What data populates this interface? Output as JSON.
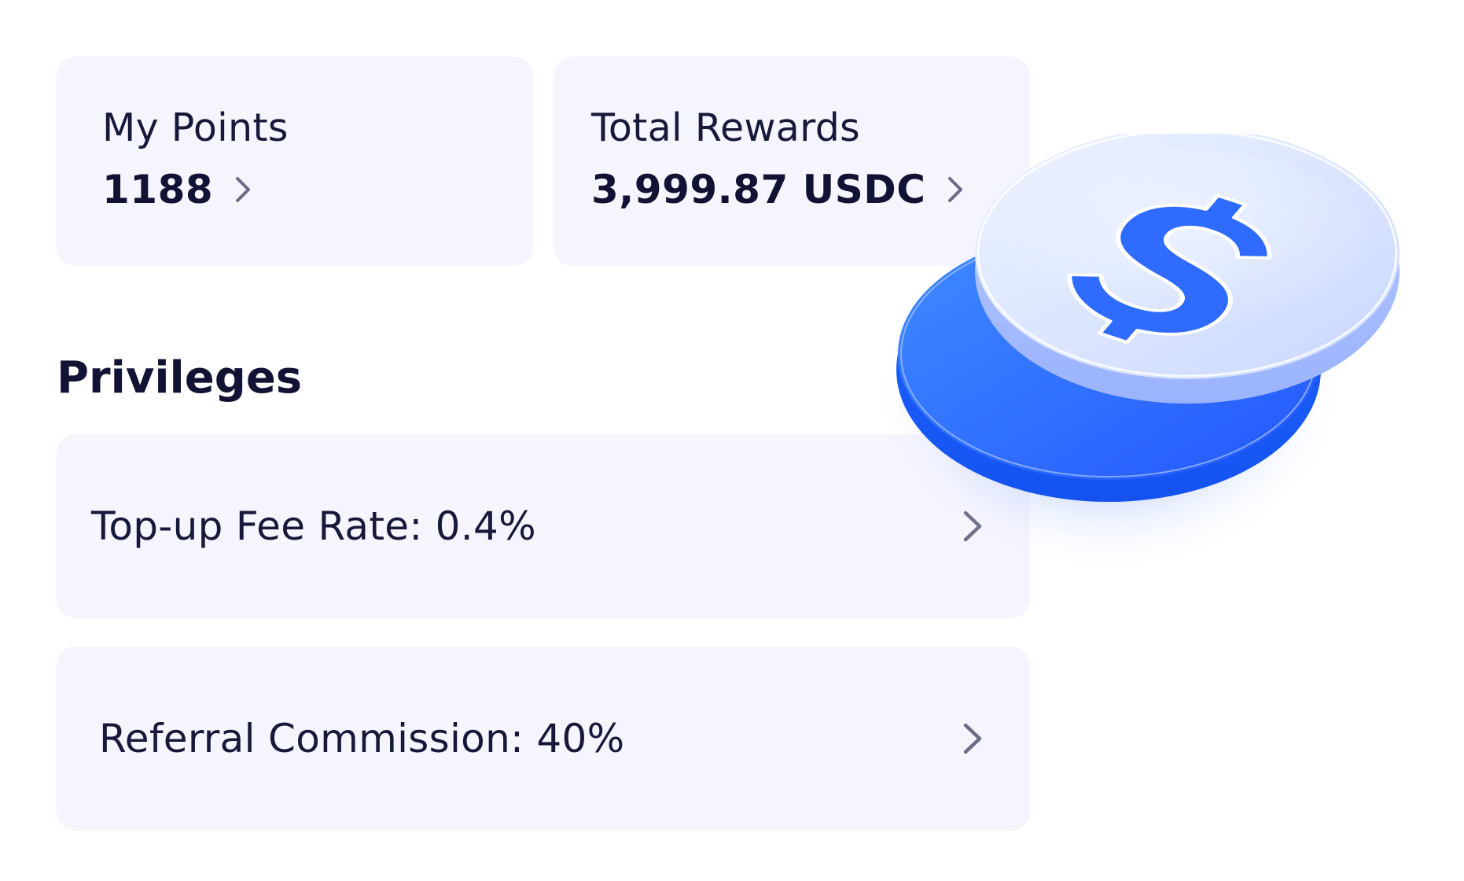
{
  "stats": {
    "points": {
      "title": "My Points",
      "value": "1188"
    },
    "rewards": {
      "title": "Total Rewards",
      "value": "3,999.87 USDC"
    }
  },
  "privileges": {
    "title": "Privileges",
    "items": [
      {
        "label": "Top-up Fee Rate: 0.4%"
      },
      {
        "label": "Referral Commission: 40%"
      }
    ]
  },
  "icons": {
    "chevron": "chevron-right-icon",
    "illustration": "dollar-coin-icon"
  },
  "colors": {
    "card_background": "#f5f5fd",
    "text_primary": "#121334",
    "chevron": "#6b6c86",
    "coin_blue": "#2a6bff",
    "coin_light": "#dfe7ff"
  }
}
